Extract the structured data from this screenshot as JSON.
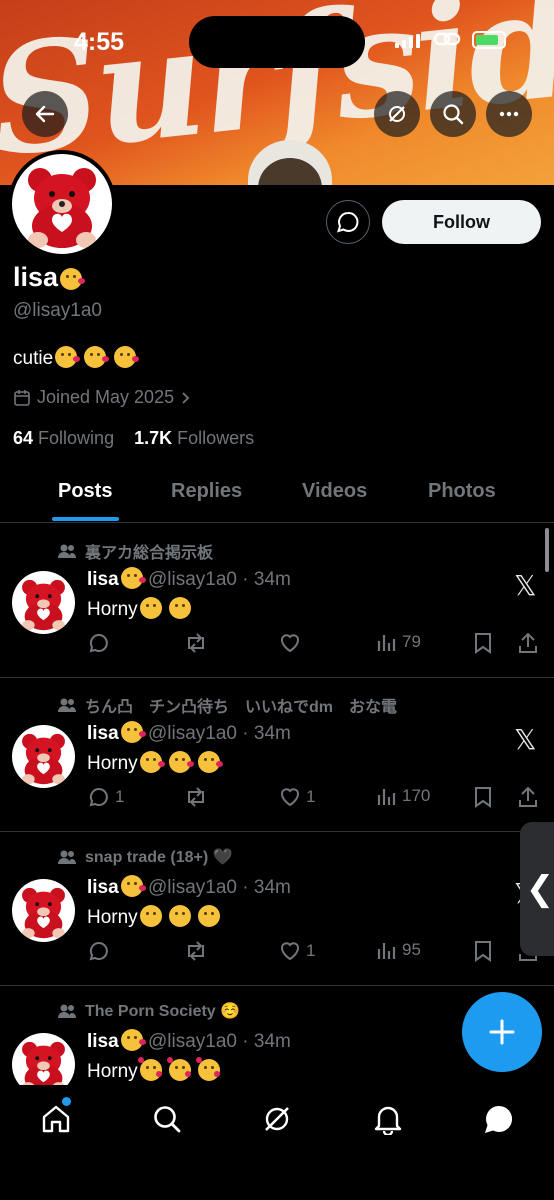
{
  "status_bar": {
    "time": "4:55"
  },
  "banner": {
    "text": "Surfside"
  },
  "profile": {
    "name": "lisa",
    "handle": "@lisay1a0",
    "bio": "cutie",
    "joined": "Joined May 2025",
    "following_count": "64",
    "following_label": "Following",
    "followers_count": "1.7K",
    "followers_label": "Followers",
    "follow_label": "Follow"
  },
  "tabs": [
    "Posts",
    "Replies",
    "Videos",
    "Photos"
  ],
  "posts": [
    {
      "community": "裏アカ総合掲示板",
      "name": "lisa",
      "handle": "@lisay1a0",
      "time": "34m",
      "text": "Horny",
      "replies": "",
      "likes": "",
      "views": "79"
    },
    {
      "community": "ちん凸　チン凸待ち　いいねでdm　おな電",
      "name": "lisa",
      "handle": "@lisay1a0",
      "time": "34m",
      "text": "Horny",
      "replies": "1",
      "likes": "1",
      "views": "170"
    },
    {
      "community": "snap trade (18+) 🖤",
      "name": "lisa",
      "handle": "@lisay1a0",
      "time": "34m",
      "text": "Horny",
      "replies": "",
      "likes": "1",
      "views": "95"
    },
    {
      "community": "The Porn Society ☺️",
      "name": "lisa",
      "handle": "@lisay1a0",
      "time": "34m",
      "text": "Horny",
      "replies": "",
      "likes": "",
      "views": ""
    }
  ],
  "colors": {
    "accent": "#1d9bf0",
    "background": "#000000",
    "muted": "#71767b"
  }
}
